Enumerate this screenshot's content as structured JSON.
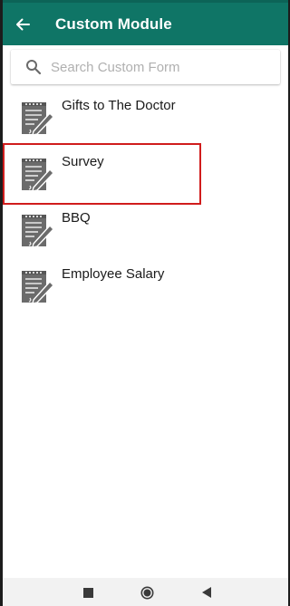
{
  "appbar": {
    "title": "Custom Module",
    "back_icon": "arrow-left-icon",
    "color": "#0f7566"
  },
  "search": {
    "placeholder": "Search Custom Form",
    "value": "",
    "icon": "search-icon"
  },
  "forms": [
    {
      "label": "Gifts to The Doctor",
      "icon": "form-document-icon"
    },
    {
      "label": "Survey",
      "icon": "form-document-icon"
    },
    {
      "label": "BBQ",
      "icon": "form-document-icon"
    },
    {
      "label": "Employee Salary",
      "icon": "form-document-icon"
    }
  ],
  "highlight": {
    "target": "Survey",
    "color": "#d01c1c"
  },
  "navbar": {
    "icons": [
      "recent-apps-icon",
      "home-icon",
      "back-triangle-icon"
    ]
  }
}
